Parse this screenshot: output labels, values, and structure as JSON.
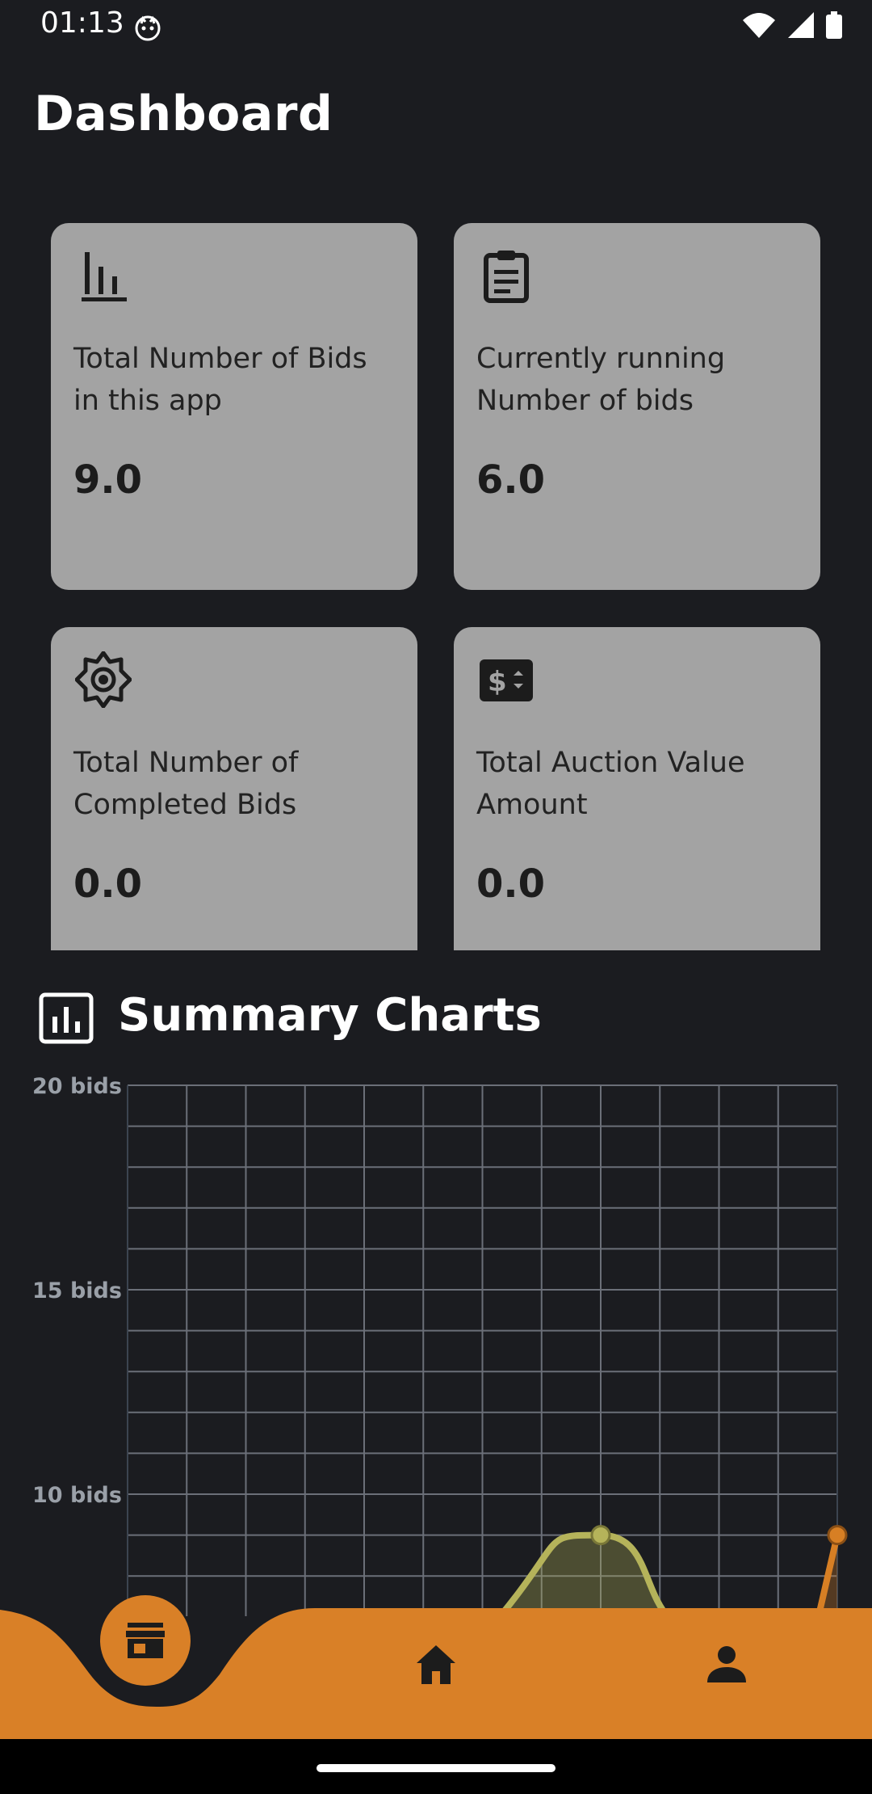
{
  "status": {
    "time": "01:13"
  },
  "page": {
    "title": "Dashboard"
  },
  "cards": [
    {
      "icon": "bar-chart-icon",
      "label": "Total Number of Bids in this app",
      "value": "9.0"
    },
    {
      "icon": "clipboard-icon",
      "label": "Currently running Number of bids",
      "value": "6.0"
    },
    {
      "icon": "brightness-gear-icon",
      "label": "Total Number of Completed Bids",
      "value": "0.0"
    },
    {
      "icon": "dollar-sign-icon",
      "label": "Total Auction Value Amount",
      "value": "0.0"
    }
  ],
  "summary": {
    "title": "Summary Charts",
    "icon": "analytics-icon"
  },
  "chart_data": {
    "type": "line",
    "ylim": [
      0,
      20
    ],
    "y_ticks": [
      "20 bids",
      "15 bids",
      "10 bids"
    ],
    "grid": true,
    "series": [
      {
        "color": "#b5b35a",
        "x": [
          6,
          8,
          10
        ],
        "values": [
          6.5,
          9,
          6.5
        ]
      },
      {
        "color": "#d77f24",
        "x": [
          11.6,
          12
        ],
        "values": [
          6.5,
          9
        ]
      }
    ],
    "xlim": [
      0,
      12
    ]
  },
  "bottom_nav": {
    "items": [
      {
        "icon": "store-icon",
        "active": true
      },
      {
        "icon": "home-icon",
        "active": false
      },
      {
        "icon": "person-icon",
        "active": false
      }
    ],
    "color": "#d98027"
  },
  "colors": {
    "background": "#1b1c20",
    "card": "#a3a3a3",
    "accent": "#d98027"
  }
}
